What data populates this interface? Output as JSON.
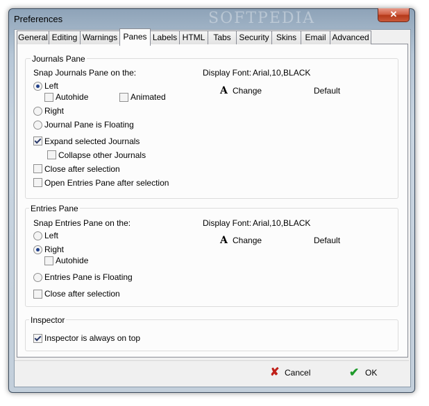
{
  "window": {
    "title": "Preferences",
    "watermark": "SOFTPEDIA",
    "close_label": "✕"
  },
  "tabs": [
    "General",
    "Editing",
    "Warnings",
    "Panes",
    "Labels",
    "HTML",
    "Tabs",
    "Security",
    "Skins",
    "Email",
    "Advanced"
  ],
  "active_tab": "Panes",
  "journals_pane": {
    "title": "Journals Pane",
    "snap_label": "Snap Journals Pane on the:",
    "display_font_label": "Display Font:",
    "display_font_value": "Arial,10,BLACK",
    "change_label": "Change",
    "default_label": "Default",
    "left": "Left",
    "autohide": "Autohide",
    "animated": "Animated",
    "right": "Right",
    "floating": "Journal Pane is Floating",
    "expand_selected": "Expand selected Journals",
    "collapse_other": "Collapse other Journals",
    "close_after": "Close after selection",
    "open_entries": "Open Entries Pane after selection"
  },
  "entries_pane": {
    "title": "Entries Pane",
    "snap_label": "Snap Entries Pane on the:",
    "display_font_label": "Display Font:",
    "display_font_value": "Arial,10,BLACK",
    "change_label": "Change",
    "default_label": "Default",
    "left": "Left",
    "right": "Right",
    "autohide": "Autohide",
    "floating": "Entries Pane is Floating",
    "close_after": "Close after selection"
  },
  "inspector": {
    "title": "Inspector",
    "always_on_top": "Inspector is always on top"
  },
  "buttons": {
    "cancel": "Cancel",
    "ok": "OK"
  },
  "state": {
    "journals_snap": "Left",
    "journals_autohide": false,
    "journals_animated": false,
    "expand_selected": true,
    "collapse_other": false,
    "journals_close_after": false,
    "open_entries_after": false,
    "entries_snap": "Right",
    "entries_autohide": false,
    "entries_close_after": false,
    "inspector_on_top": true
  },
  "colors": {
    "cancel_icon": "#c0201a",
    "ok_icon": "#1e9a2a"
  }
}
